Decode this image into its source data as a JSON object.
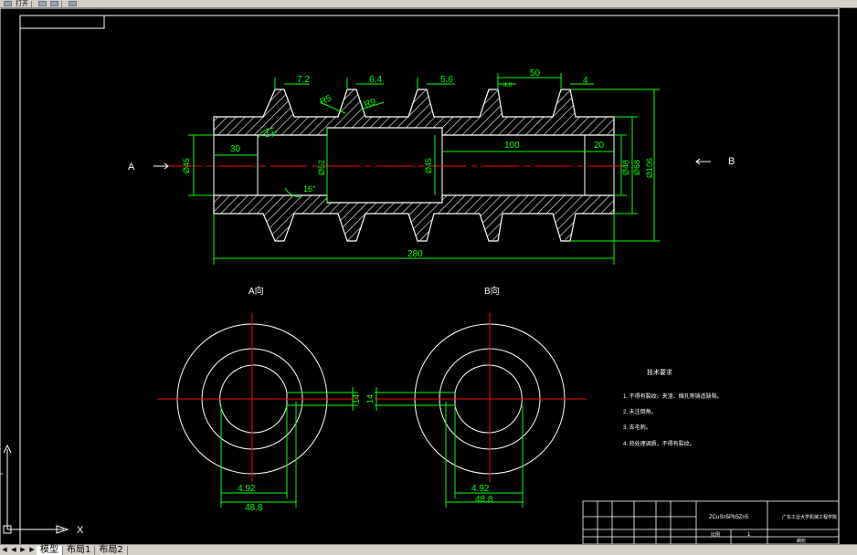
{
  "toolbar": {
    "open_label": "打开"
  },
  "tabs": [
    "模型",
    "布局1",
    "布局2"
  ],
  "views": {
    "left_arrow_label": "A",
    "right_arrow_label": "B",
    "section_a": "A向",
    "section_b": "B向"
  },
  "dims": {
    "d7_2": "7.2",
    "d6_4": "6.4",
    "d5_6": "5.6",
    "d50": "50",
    "d4": "4",
    "d4_8": "4.8",
    "r5": "R5",
    "r9": "R9",
    "ang14": "14°",
    "ang16": "16°",
    "d30": "30",
    "d100": "100",
    "d20": "20",
    "phi45l": "Ø45",
    "phi52": "Ø52",
    "phi45": "Ø45",
    "phi48": "Ø48",
    "phi68": "Ø68",
    "phi106": "Ø106",
    "d280": "280",
    "d14a": "14",
    "d14b": "14",
    "d4_92a": "4.92",
    "d48_8a": "48.8",
    "d4_92b": "4.92",
    "d48_8b": "48.8"
  },
  "tech_req": {
    "title": "技术要求",
    "items": [
      "1. 不得有裂纹、夹渣、缩孔等铸造缺陷。",
      "2. 未注倒角。",
      "3. 去毛刺。",
      "4. 热处理调质，不得有裂纹。"
    ]
  },
  "title_block": {
    "material": "ZCuSn5Pb5Zn5",
    "school": "广东工业大学机械工程学院",
    "scale_label": "比例",
    "scale_value": "1",
    "drawing_name": "蜗轮"
  },
  "ucs": {
    "x_label": "X",
    "y_label": "Y"
  },
  "colors": {
    "background": "#000000",
    "geometry": "#ffffff",
    "dimension": "#00ff00",
    "centerline": "#ff0000"
  }
}
